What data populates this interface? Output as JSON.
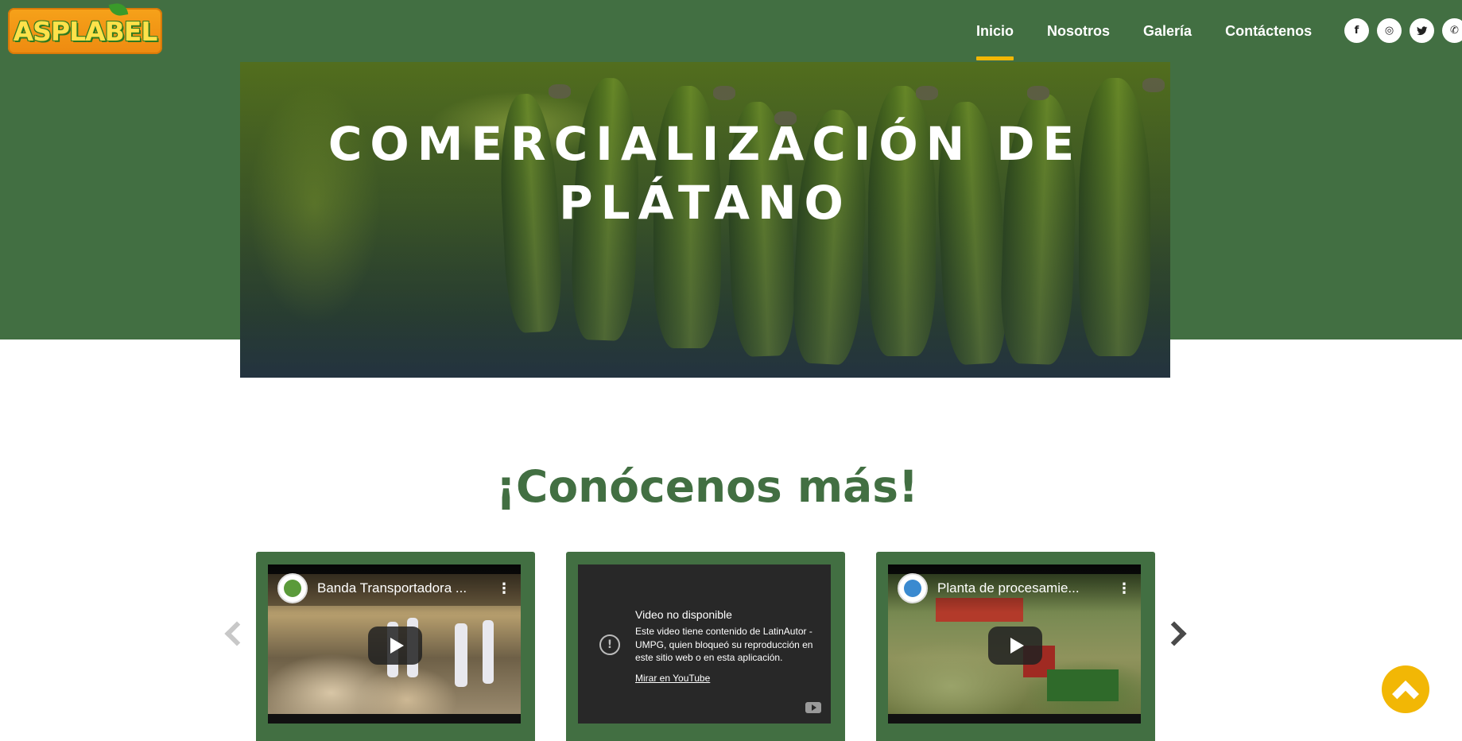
{
  "brand": {
    "logo_text": "ASPLABEL"
  },
  "nav": {
    "items": [
      {
        "label": "Inicio",
        "active": true
      },
      {
        "label": "Nosotros",
        "active": false
      },
      {
        "label": "Galería",
        "active": false
      },
      {
        "label": "Contáctenos",
        "active": false
      }
    ],
    "accent_color": "#f2b705"
  },
  "social": [
    {
      "icon": "facebook-icon",
      "glyph": "f"
    },
    {
      "icon": "instagram-icon",
      "glyph": "◎"
    },
    {
      "icon": "twitter-icon",
      "glyph": "🐦"
    },
    {
      "icon": "whatsapp-icon",
      "glyph": "✆"
    }
  ],
  "hero": {
    "title_line1": "COMERCIALIZACIÓN DE",
    "title_line2": "PLÁTANO"
  },
  "section": {
    "title": "¡Conócenos más!"
  },
  "videos": [
    {
      "title": "Banda Transportadora ...",
      "menu": "⋮"
    },
    {
      "unavailable_title": "Video no disponible",
      "unavailable_body": "Este video tiene contenido de LatinAutor - UMPG, quien bloqueó su reproducción en este sitio web o en esta aplicación.",
      "unavailable_link": "Mirar en YouTube"
    },
    {
      "title": "Planta de procesamie...",
      "menu": "⋮"
    }
  ],
  "colors": {
    "primary_green": "#426f42",
    "accent_yellow": "#f2b705"
  }
}
